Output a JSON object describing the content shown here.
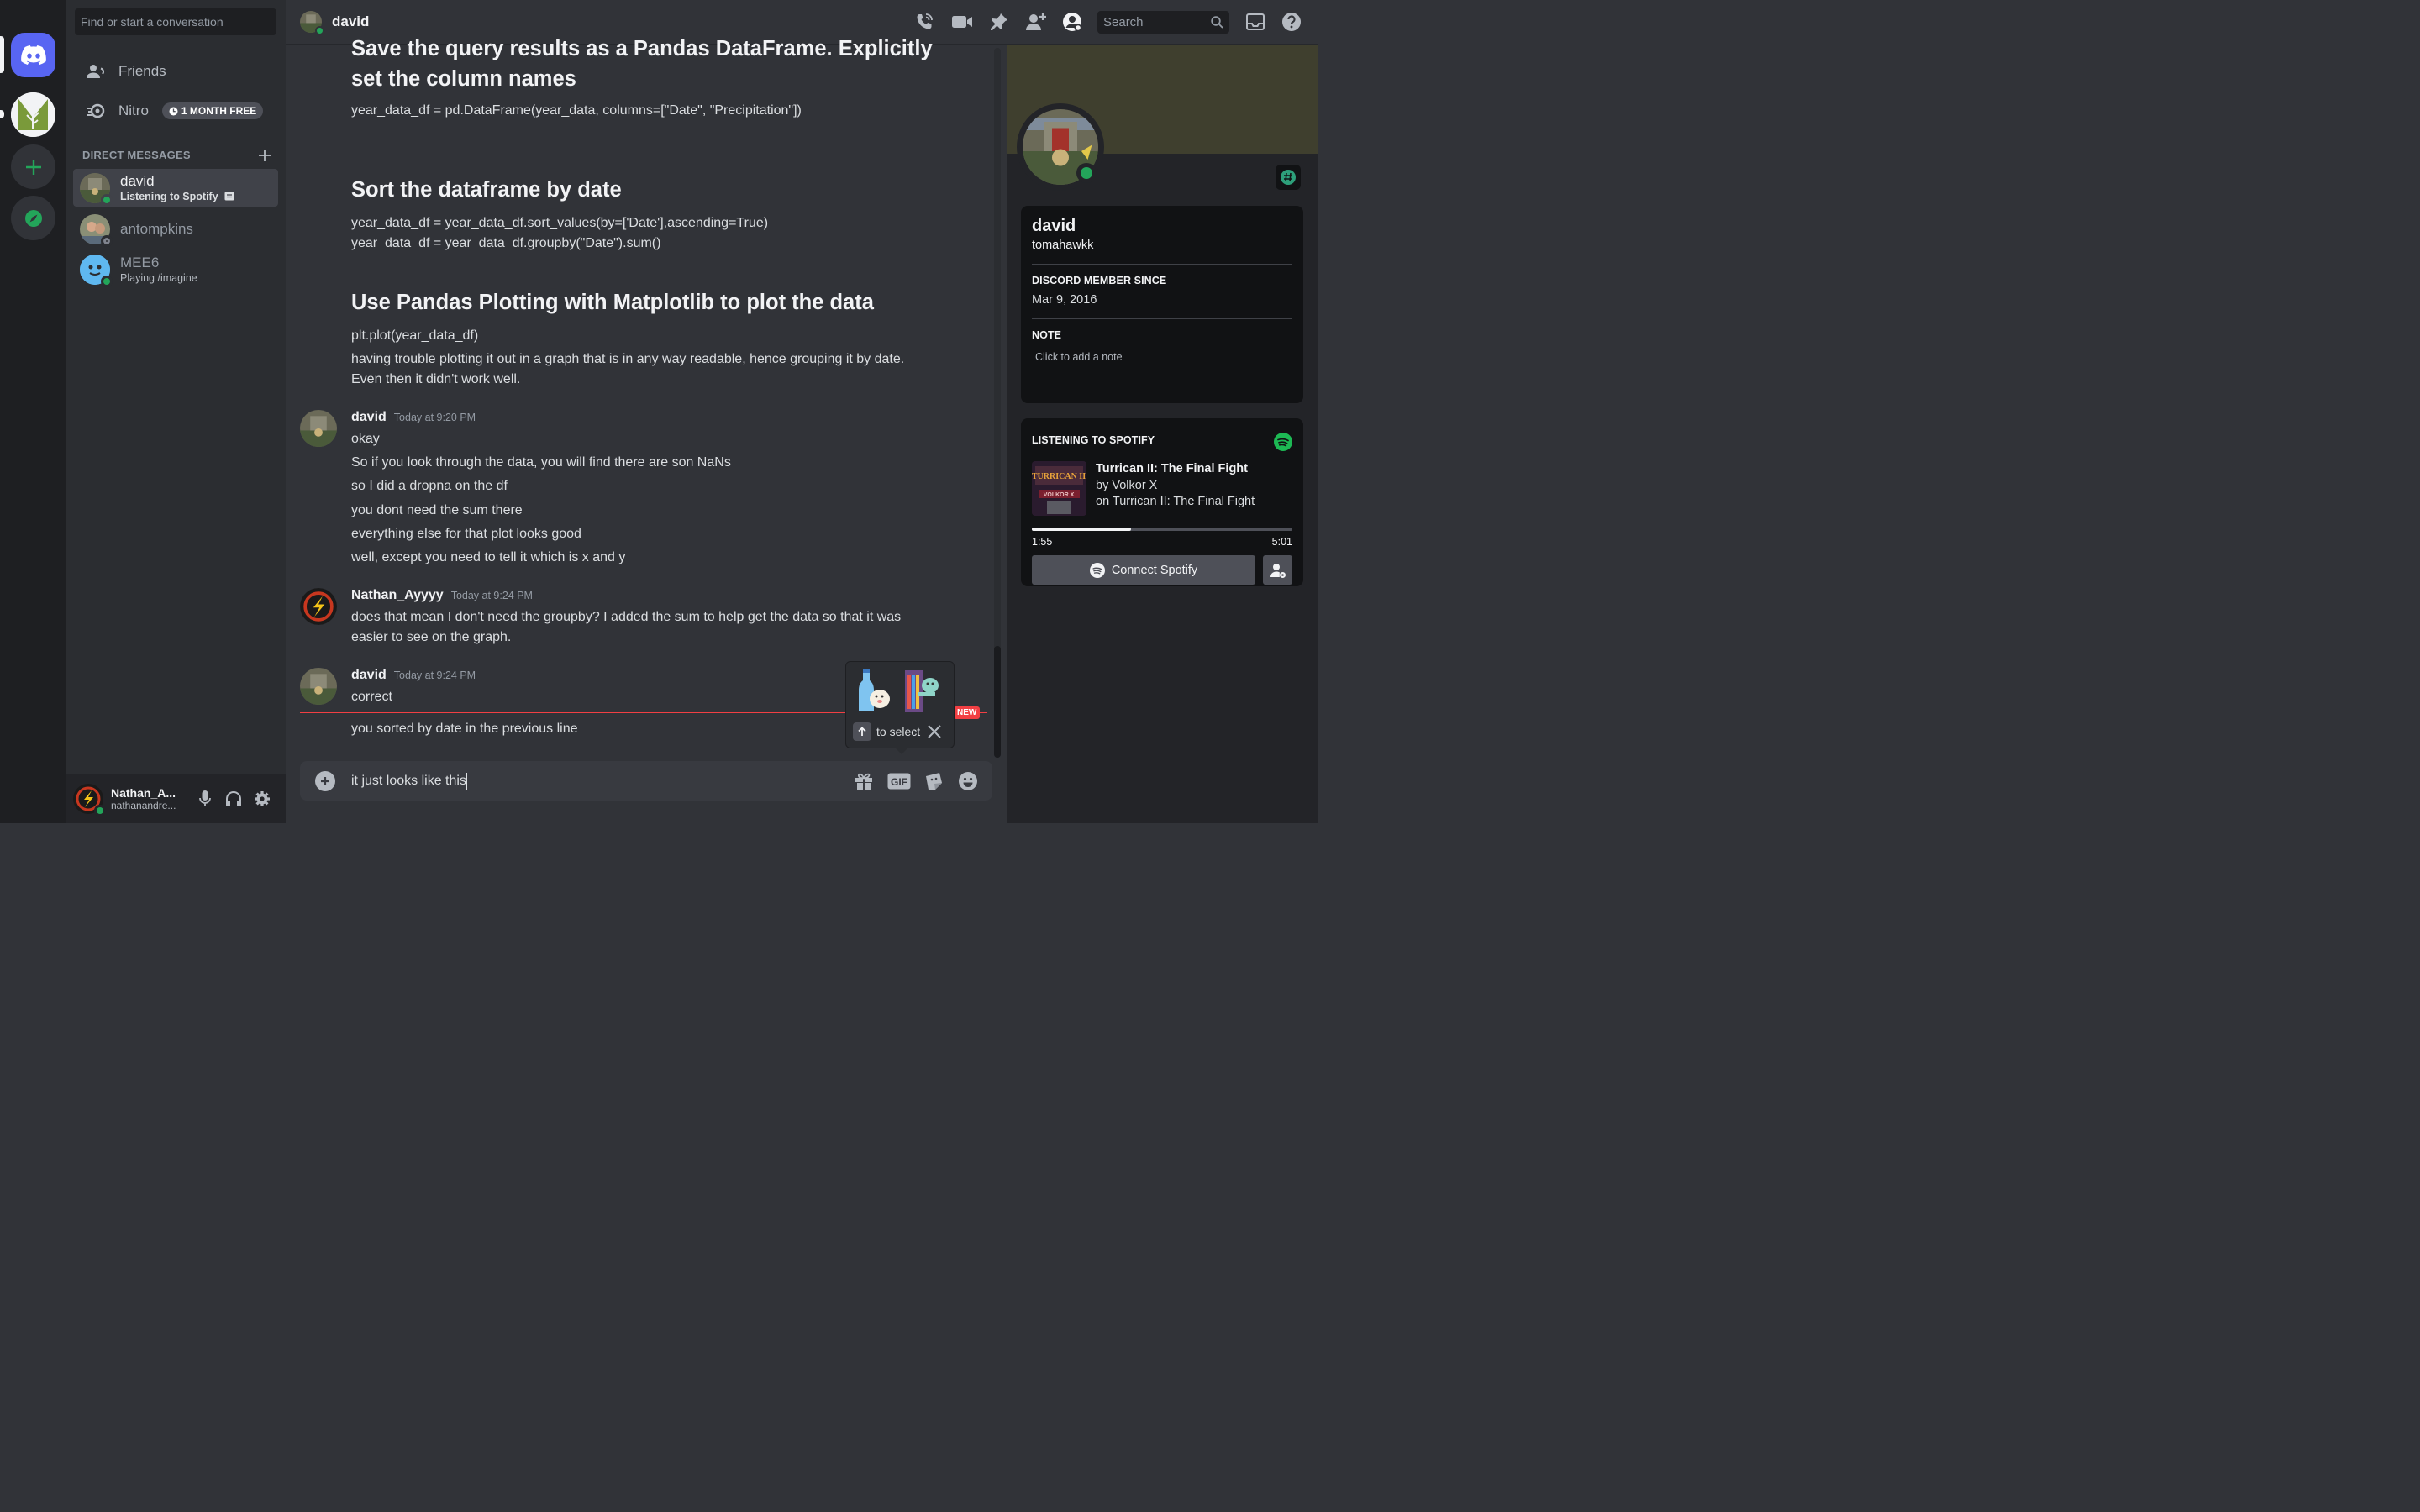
{
  "search": {
    "placeholder": "Find or start a conversation"
  },
  "nav": {
    "friends": "Friends",
    "nitro": "Nitro",
    "nitro_badge": "1 MONTH FREE"
  },
  "direct_messages": {
    "header": "DIRECT MESSAGES",
    "items": [
      {
        "name": "david",
        "sub": "Listening to Spotify",
        "status": "online",
        "status_color": "#23a55a"
      },
      {
        "name": "antompkins",
        "sub": "",
        "status": "offline",
        "status_color": "#80848e"
      },
      {
        "name": "MEE6",
        "sub": "Playing /imagine",
        "status": "online",
        "status_color": "#23a55a"
      }
    ]
  },
  "user": {
    "display": "Nathan_A...",
    "username": "nathanandre..."
  },
  "topbar": {
    "name": "david",
    "search_placeholder": "Search"
  },
  "chat": {
    "blocks": [
      {
        "heading": "Save the query results as a Pandas DataFrame. Explicitly set the column names"
      },
      {
        "line": "year_data_df = pd.DataFrame(year_data, columns=[\"Date\", \"Precipitation\"])"
      },
      {
        "heading": "Sort the dataframe by date"
      },
      {
        "line": "year_data_df = year_data_df.sort_values(by=['Date'],ascending=True)"
      },
      {
        "line": "year_data_df = year_data_df.groupby(\"Date\").sum()"
      },
      {
        "heading": "Use Pandas Plotting with Matplotlib to plot the data"
      },
      {
        "line": "plt.plot(year_data_df)"
      },
      {
        "line": "having trouble plotting it out in a graph that is in any way readable, hence grouping it by date."
      },
      {
        "line": "Even then it didn't work well."
      }
    ],
    "messages": [
      {
        "author": "david",
        "time": "Today at 9:20 PM",
        "lines": [
          "okay",
          "So if you look through the data, you will find there are son NaNs",
          "so I did a dropna on the df",
          "you dont need the sum there",
          "everything else for that plot looks good",
          "well, except you need to tell it which is x and y"
        ]
      },
      {
        "author": "Nathan_Ayyyy",
        "time": "Today at 9:24 PM",
        "lines": [
          "does that mean I don't need the groupby? I added the sum to help get the data so that it was",
          "easier to see on the graph."
        ]
      },
      {
        "author": "david",
        "time": "Today at 9:24 PM",
        "lines": [
          "correct",
          "you sorted by date in the previous line"
        ]
      }
    ],
    "new_badge": "NEW",
    "composer_text": "it just looks like this",
    "sticker_hint": "to select"
  },
  "profile": {
    "name": "david",
    "handle": "tomahawkk",
    "member_since_label": "DISCORD MEMBER SINCE",
    "member_since": "Mar 9, 2016",
    "note_label": "NOTE",
    "note_placeholder": "Click to add a note",
    "spotify": {
      "label": "LISTENING TO SPOTIFY",
      "track": "Turrican II: The Final Fight",
      "artist": "by Volkor X",
      "album": "on Turrican II: The Final Fight",
      "elapsed": "1:55",
      "duration": "5:01",
      "progress": 0.382,
      "connect_label": "Connect Spotify"
    }
  },
  "colors": {
    "accent": "#5865f2",
    "online": "#23a55a",
    "danger": "#f23f43",
    "spotify": "#1db954"
  }
}
